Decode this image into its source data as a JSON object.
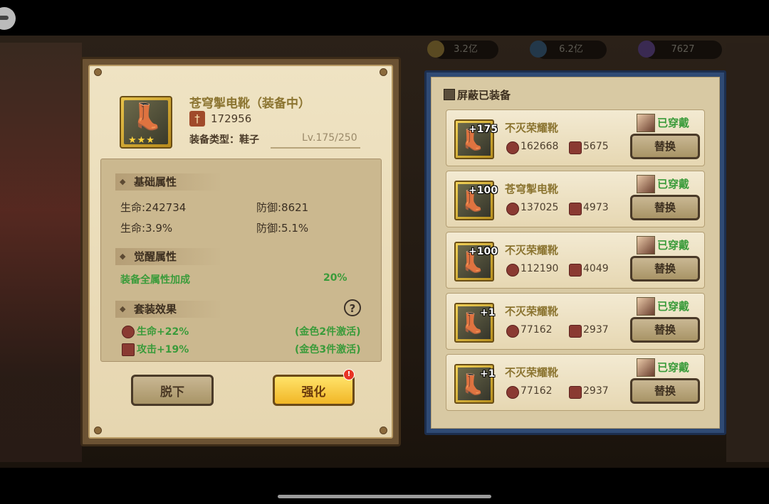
{
  "currency": [
    {
      "value": "3.2亿",
      "color": "#b8902a"
    },
    {
      "value": "6.2亿",
      "color": "#4a86b8"
    },
    {
      "value": "7627",
      "color": "#8a5ac8"
    }
  ],
  "detail": {
    "name": "苍穹掣电靴（装备中）",
    "power": "172956",
    "type_label": "装备类型：鞋子",
    "level": "Lv.175/250",
    "stars": "★★★",
    "base_title": "基础属性",
    "base": [
      {
        "left": "生命:242734",
        "right": "防御:8621"
      },
      {
        "left": "生命:3.9%",
        "right": "防御:5.1%"
      }
    ],
    "awaken_title": "觉醒属性",
    "awaken_label": "装备全属性加成",
    "awaken_value": "20%",
    "set_title": "套装效果",
    "help": "?",
    "set_effects": [
      {
        "label": "生命+22%",
        "cond": "(金色2件激活)"
      },
      {
        "label": "攻击+19%",
        "cond": "(金色3件激活)"
      }
    ],
    "unequip_label": "脱下",
    "upgrade_label": "强化",
    "upgrade_badge": "!"
  },
  "list": {
    "filter_label": "屏蔽已装备",
    "rows": [
      {
        "plus": "+175",
        "name": "不灭荣耀靴",
        "hp": "162668",
        "def": "5675",
        "status": "已穿戴",
        "button": "替换"
      },
      {
        "plus": "+100",
        "name": "苍穹掣电靴",
        "hp": "137025",
        "def": "4973",
        "status": "已穿戴",
        "button": "替换"
      },
      {
        "plus": "+100",
        "name": "不灭荣耀靴",
        "hp": "112190",
        "def": "4049",
        "status": "已穿戴",
        "button": "替换"
      },
      {
        "plus": "+1",
        "name": "不灭荣耀靴",
        "hp": "77162",
        "def": "2937",
        "status": "已穿戴",
        "button": "替换"
      },
      {
        "plus": "+1",
        "name": "不灭荣耀靴",
        "hp": "77162",
        "def": "2937",
        "status": "已穿戴",
        "button": "替换"
      }
    ]
  }
}
